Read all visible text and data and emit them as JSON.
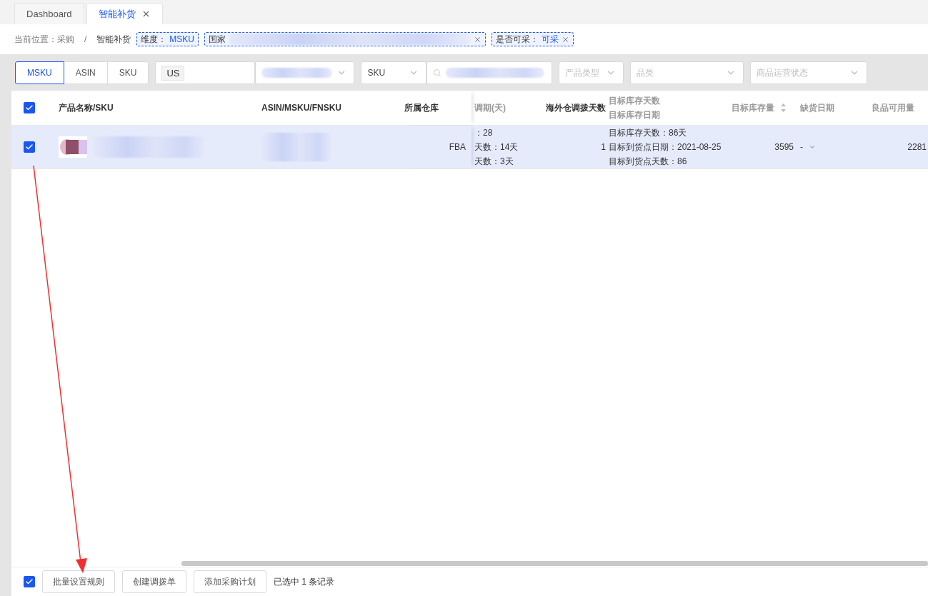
{
  "tabs": [
    {
      "label": "Dashboard",
      "selected": false,
      "closable": false
    },
    {
      "label": "智能补货",
      "selected": true,
      "closable": true
    }
  ],
  "breadcrumb": {
    "label": "当前位置：",
    "items": [
      "采购",
      "智能补货"
    ],
    "separator": "/"
  },
  "filter_tags": [
    {
      "kind": "text",
      "label": "维度：",
      "value": "MSKU",
      "closable": false
    },
    {
      "kind": "blurred",
      "label": "国家",
      "closable": true
    },
    {
      "kind": "text",
      "label": "是否可采：",
      "value": "可采",
      "closable": true
    }
  ],
  "filters": {
    "view_modes": [
      {
        "label": "MSKU",
        "selected": true
      },
      {
        "label": "ASIN",
        "selected": false
      },
      {
        "label": "SKU",
        "selected": false
      }
    ],
    "fields": [
      {
        "kind": "tag-select",
        "tag": "US"
      },
      {
        "kind": "blurred-select"
      },
      {
        "kind": "select",
        "value": "SKU"
      },
      {
        "kind": "blurred-input"
      },
      {
        "kind": "select",
        "placeholder": "产品类型"
      },
      {
        "kind": "select",
        "placeholder": "品类"
      },
      {
        "kind": "select",
        "placeholder": "商品运营状态"
      }
    ]
  },
  "table": {
    "all_checked": true,
    "columns": [
      {
        "kind": "plain",
        "lines": [
          "产品名称/SKU"
        ],
        "muted": false
      },
      {
        "kind": "plain",
        "lines": [
          "ASIN/MSKU/FNSKU"
        ],
        "muted": false
      },
      {
        "kind": "plain",
        "lines": [
          "所属仓库"
        ],
        "muted": false
      },
      {
        "kind": "plain",
        "lines": [
          "调期(天)"
        ],
        "muted": true
      },
      {
        "kind": "plain",
        "lines": [
          "海外仓调拨天数"
        ],
        "muted": false
      },
      {
        "kind": "plain",
        "lines": [
          "目标库存天数",
          "目标库存日期"
        ],
        "muted": true
      },
      {
        "kind": "sortable",
        "lines": [
          "目标库存量"
        ],
        "muted": true
      },
      {
        "kind": "plain",
        "lines": [
          "缺货日期"
        ],
        "muted": true
      },
      {
        "kind": "plain",
        "lines": [
          "良品可用量"
        ],
        "muted": true
      }
    ],
    "rows": [
      {
        "selected": true,
        "checked": true,
        "cells": [
          {
            "kind": "blurred-product"
          },
          {
            "kind": "blurred"
          },
          {
            "kind": "text",
            "text": "FBA"
          },
          {
            "kind": "lines",
            "lines": [
              "：28",
              "天数：14天",
              "天数：3天"
            ]
          },
          {
            "kind": "text",
            "text": "1"
          },
          {
            "kind": "lines",
            "lines": [
              "目标库存天数：86天",
              "目标到货点日期：2021-08-25",
              "目标到货点天数：86"
            ]
          },
          {
            "kind": "text",
            "text": "3595"
          },
          {
            "kind": "dropdown",
            "text": "-"
          },
          {
            "kind": "text",
            "text": "2281"
          }
        ]
      }
    ]
  },
  "footer": {
    "checked": true,
    "buttons": [
      "批量设置规则",
      "创建调拨单",
      "添加采购计划"
    ],
    "summary": "已选中 1 条记录"
  }
}
